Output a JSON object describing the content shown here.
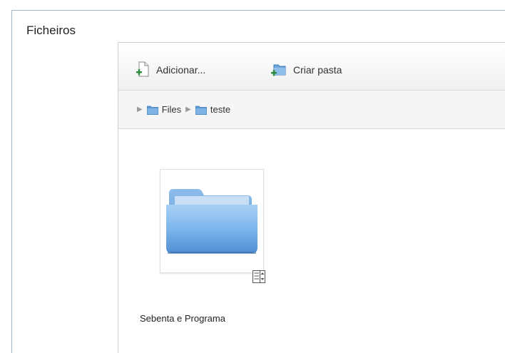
{
  "section": {
    "label": "Ficheiros"
  },
  "toolbar": {
    "add_label": "Adicionar...",
    "create_folder_label": "Criar pasta"
  },
  "breadcrumb": {
    "items": [
      {
        "label": "Files",
        "icon": "folder-icon"
      },
      {
        "label": "teste",
        "icon": "folder-icon"
      }
    ]
  },
  "files": [
    {
      "name": "Sebenta e Programa",
      "type": "folder",
      "icon": "folder-icon"
    }
  ],
  "colors": {
    "folder_blue": "#5b9bd5",
    "border": "#9fb6cd"
  }
}
